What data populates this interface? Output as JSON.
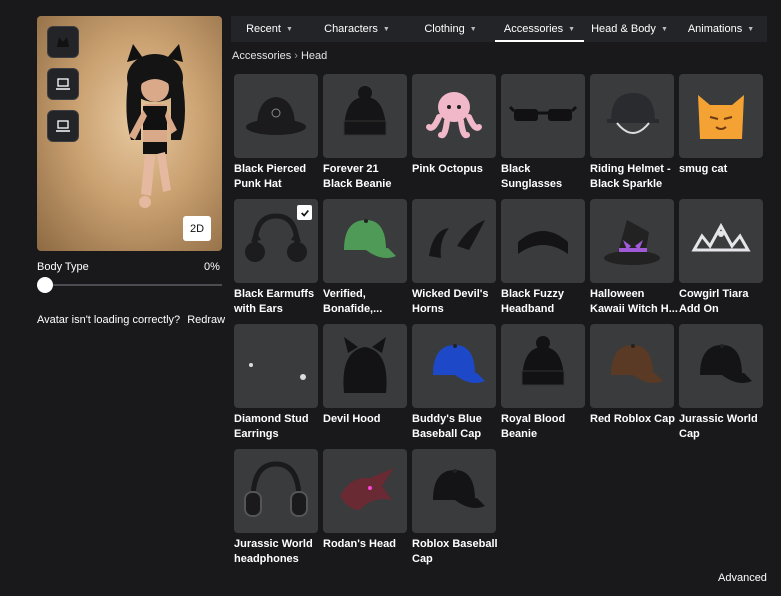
{
  "preview": {
    "toggle_2d_label": "2D",
    "thumbnails": [
      "cat-ears-icon",
      "laptop-icon",
      "laptop-icon"
    ]
  },
  "body_type": {
    "label": "Body Type",
    "value": "0%"
  },
  "loading": {
    "question": "Avatar isn't loading correctly?",
    "redraw_label": "Redraw"
  },
  "tabs": [
    {
      "label": "Recent",
      "active": false
    },
    {
      "label": "Characters",
      "active": false
    },
    {
      "label": "Clothing",
      "active": false
    },
    {
      "label": "Accessories",
      "active": true
    },
    {
      "label": "Head & Body",
      "active": false
    },
    {
      "label": "Animations",
      "active": false
    }
  ],
  "breadcrumb": {
    "parent": "Accessories",
    "current": "Head"
  },
  "items": [
    {
      "name": "Black Pierced Punk Hat",
      "icon": "bucket-hat-icon",
      "color": "#1b1b1d",
      "selected": false
    },
    {
      "name": "Forever 21 Black Beanie",
      "icon": "beanie-icon",
      "color": "#151517",
      "selected": false
    },
    {
      "name": "Pink Octopus",
      "icon": "octopus-icon",
      "color": "#f0b8c8",
      "selected": false
    },
    {
      "name": "Black Sunglasses",
      "icon": "sunglasses-icon",
      "color": "#111113",
      "selected": false
    },
    {
      "name": "Riding Helmet - Black Sparkle",
      "icon": "helmet-icon",
      "color": "#2a2b2e",
      "selected": false
    },
    {
      "name": "smug cat",
      "icon": "cat-hat-icon",
      "color": "#f4a233",
      "selected": false
    },
    {
      "name": "Black Earmuffs with Ears",
      "icon": "earmuffs-icon",
      "color": "#1c1c1e",
      "selected": true
    },
    {
      "name": "Verified, Bonafide,...",
      "icon": "cap-icon",
      "color": "#4f9a57",
      "selected": false
    },
    {
      "name": "Wicked Devil's Horns",
      "icon": "horns-icon",
      "color": "#161618",
      "selected": false
    },
    {
      "name": "Black Fuzzy Headband",
      "icon": "headband-icon",
      "color": "#141416",
      "selected": false
    },
    {
      "name": "Halloween Kawaii Witch H...",
      "icon": "witch-hat-icon",
      "color": "#a05ad8",
      "selected": false
    },
    {
      "name": "Cowgirl Tiara Add On",
      "icon": "tiara-icon",
      "color": "#e6e6ea",
      "selected": false
    },
    {
      "name": "Diamond Stud Earrings",
      "icon": "earrings-icon",
      "color": "#dcdce0",
      "selected": false
    },
    {
      "name": "Devil Hood",
      "icon": "hood-icon",
      "color": "#131315",
      "selected": false
    },
    {
      "name": "Buddy's Blue Baseball Cap",
      "icon": "cap-icon",
      "color": "#1d49c9",
      "selected": false
    },
    {
      "name": "Royal Blood Beanie",
      "icon": "beanie-icon",
      "color": "#121214",
      "selected": false
    },
    {
      "name": "Red Roblox Cap",
      "icon": "cap-icon",
      "color": "#5a3a24",
      "selected": false
    },
    {
      "name": "Jurassic World Cap",
      "icon": "cap-icon",
      "color": "#141416",
      "selected": false
    },
    {
      "name": "Jurassic World headphones",
      "icon": "headphones-icon",
      "color": "#1a1a1c",
      "selected": false
    },
    {
      "name": "Rodan's Head",
      "icon": "dragon-head-icon",
      "color": "#6a2a33",
      "selected": false
    },
    {
      "name": "Roblox Baseball Cap",
      "icon": "cap-icon",
      "color": "#141416",
      "selected": false
    }
  ],
  "footer": {
    "advanced_label": "Advanced"
  }
}
